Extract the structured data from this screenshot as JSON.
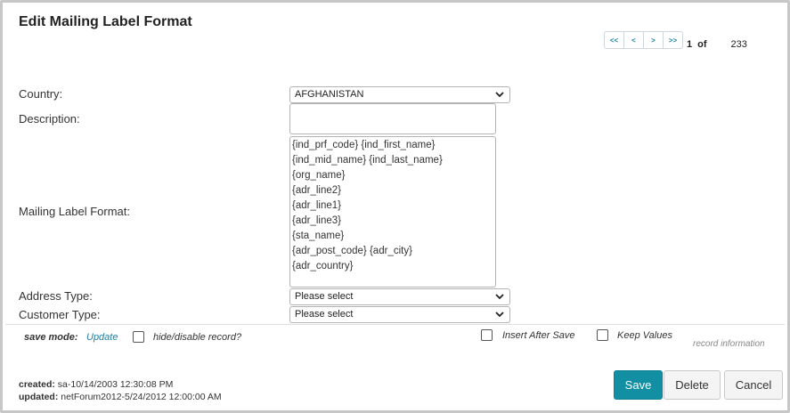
{
  "header": {
    "title": "Edit Mailing Label Format"
  },
  "pager": {
    "first": "<<",
    "prev": "<",
    "next": ">",
    "last": ">>",
    "current": "1",
    "of": "of",
    "total": "233"
  },
  "form": {
    "country": {
      "label": "Country:",
      "value": "AFGHANISTAN"
    },
    "description": {
      "label": "Description:",
      "value": ""
    },
    "mailing_label_format": {
      "label": "Mailing Label Format:",
      "lines": [
        "{ind_prf_code} {ind_first_name}",
        "{ind_mid_name} {ind_last_name}",
        "{org_name}",
        "{adr_line2}",
        "{adr_line1}",
        "{adr_line3}",
        "{sta_name}",
        "{adr_post_code} {adr_city}",
        "{adr_country}"
      ]
    },
    "address_type": {
      "label": "Address Type:",
      "value": "Please select"
    },
    "customer_type": {
      "label": "Customer Type:",
      "value": "Please select"
    }
  },
  "footer": {
    "save_mode_label": "save mode:",
    "save_mode_value": "Update",
    "hide_disable_label": "hide/disable record?",
    "insert_after_save_label": "Insert After Save",
    "keep_values_label": "Keep Values",
    "record_information": "record information",
    "created_label": "created:",
    "created_value": "sa-10/14/2003 12:30:08 PM",
    "updated_label": "updated:",
    "updated_value": "netForum2012-5/24/2012 12:00:00 AM",
    "save": "Save",
    "delete": "Delete",
    "cancel": "Cancel"
  },
  "colors": {
    "accent": "#138fa3",
    "link": "#1a7fa3"
  }
}
